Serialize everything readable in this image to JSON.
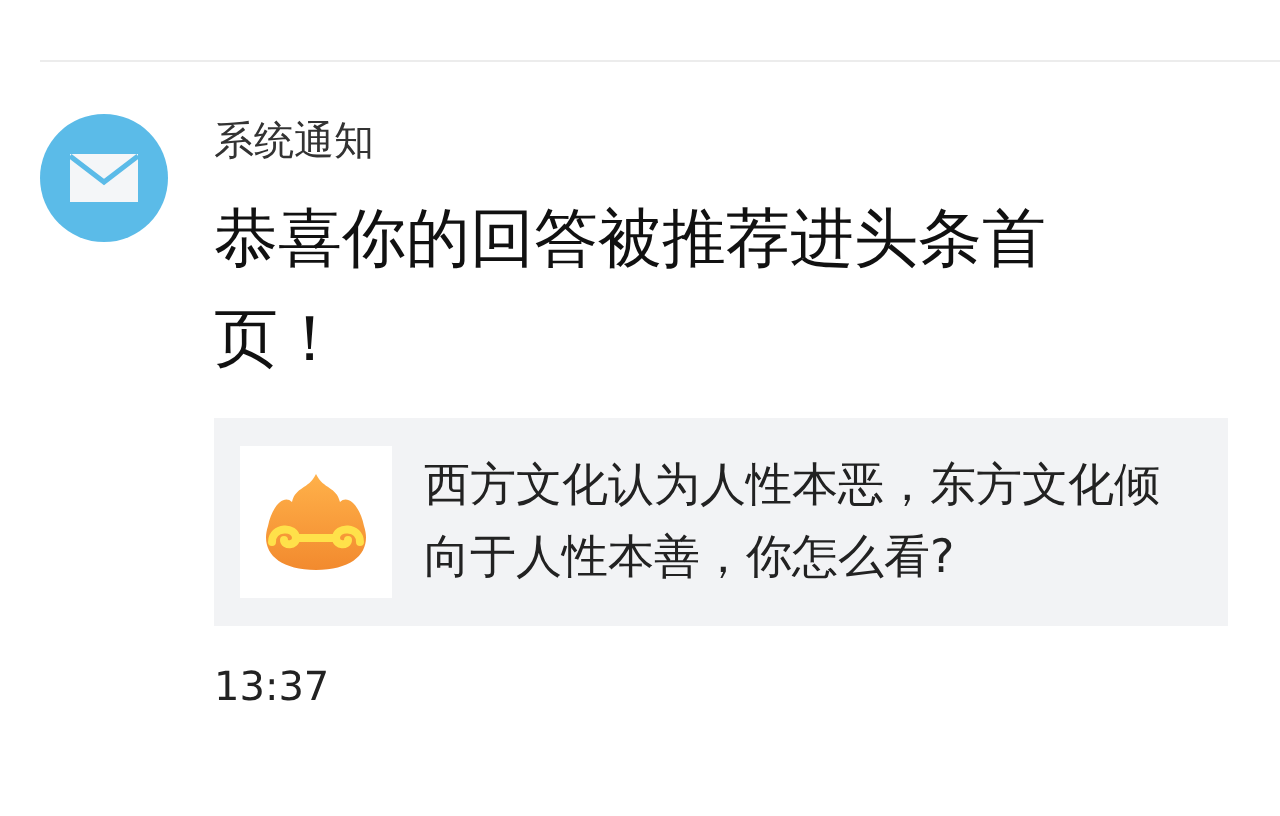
{
  "notification": {
    "sender": "系统通知",
    "message": "恭喜你的回答被推荐进头条首页！",
    "linked_question": {
      "text": "西方文化认为人性本恶，东方文化倾向于人性本善，你怎么看?"
    },
    "time": "13:37"
  }
}
